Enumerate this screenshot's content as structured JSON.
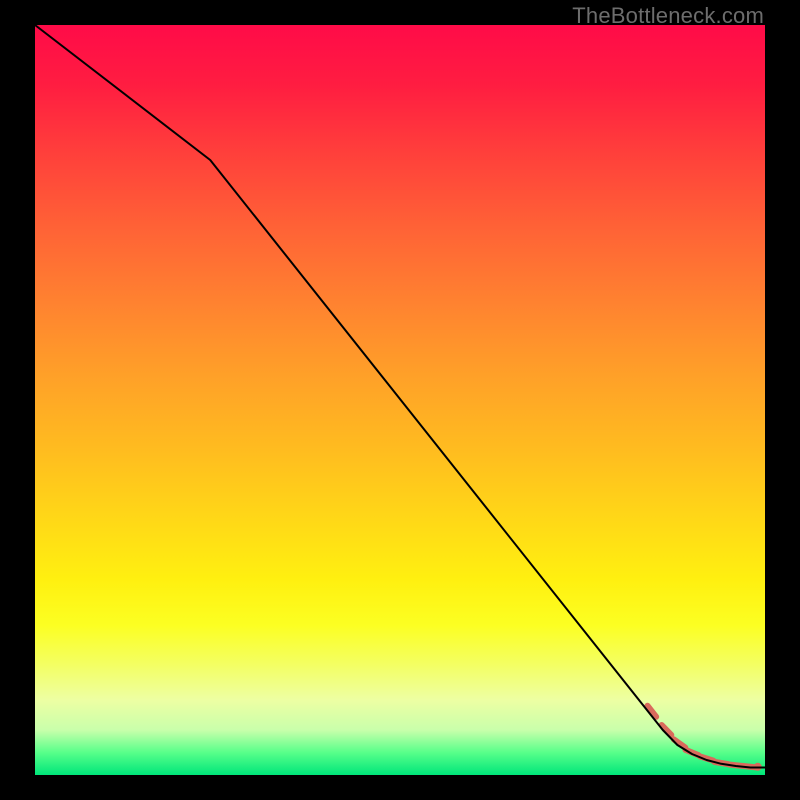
{
  "watermark": "TheBottleneck.com",
  "chart_data": {
    "type": "line",
    "title": "",
    "xlabel": "",
    "ylabel": "",
    "xlim": [
      0,
      100
    ],
    "ylim": [
      0,
      100
    ],
    "series": [
      {
        "name": "curve",
        "x": [
          0,
          24,
          86,
          88,
          90,
          92,
          94,
          96,
          98,
          100
        ],
        "values": [
          100,
          82,
          6,
          4,
          2.8,
          2,
          1.5,
          1.2,
          1,
          1
        ],
        "color": "#000000",
        "lw": 2
      }
    ],
    "crosses": {
      "comment": "salmon dashed segment markers near the trough",
      "color": "#d96a5c",
      "lw": 6,
      "points_x": [
        84.5,
        86.5,
        88.3,
        90.0,
        92.0,
        94.0,
        96.0,
        98.0
      ],
      "points_y": [
        8.5,
        6.0,
        4.2,
        3.0,
        2.2,
        1.6,
        1.3,
        1.1
      ],
      "end_dot": {
        "x": 99.0,
        "y": 1.1,
        "r": 4
      }
    }
  }
}
